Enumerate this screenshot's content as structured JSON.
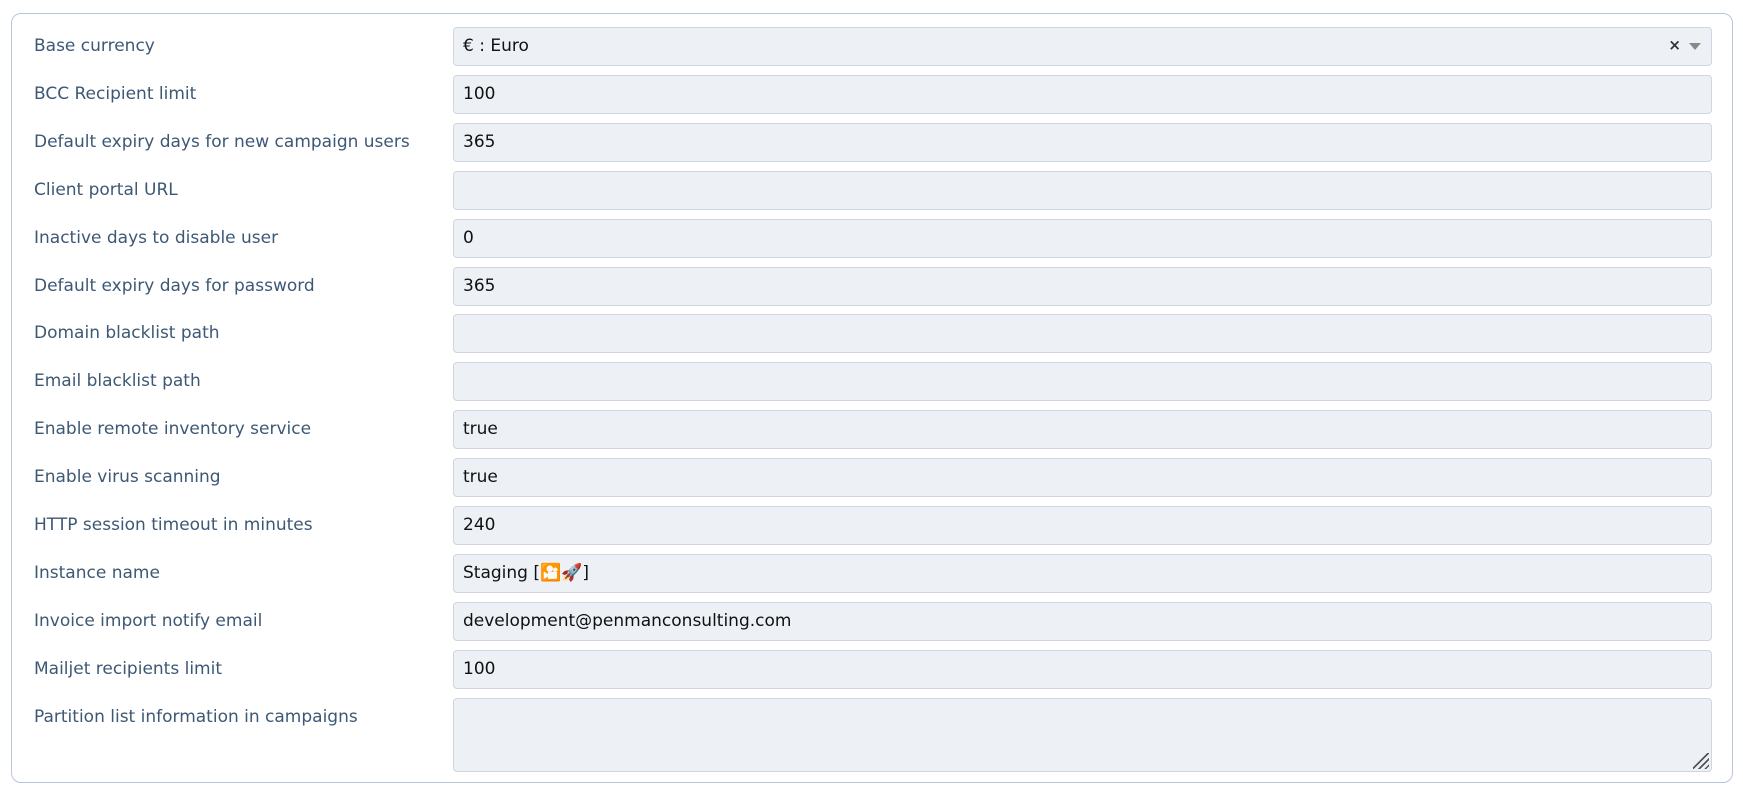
{
  "settings": [
    {
      "label": "Base currency",
      "value": "€ : Euro",
      "type": "select"
    },
    {
      "label": "BCC Recipient limit",
      "value": "100",
      "type": "input"
    },
    {
      "label": "Default expiry days for new campaign users",
      "value": "365",
      "type": "input"
    },
    {
      "label": "Client portal URL",
      "value": "",
      "type": "input"
    },
    {
      "label": "Inactive days to disable user",
      "value": "0",
      "type": "input"
    },
    {
      "label": "Default expiry days for password",
      "value": "365",
      "type": "input"
    },
    {
      "label": "Domain blacklist path",
      "value": "",
      "type": "input"
    },
    {
      "label": "Email blacklist path",
      "value": "",
      "type": "input"
    },
    {
      "label": "Enable remote inventory service",
      "value": "true",
      "type": "input"
    },
    {
      "label": "Enable virus scanning",
      "value": "true",
      "type": "input"
    },
    {
      "label": "HTTP session timeout in minutes",
      "value": "240",
      "type": "input"
    },
    {
      "label": "Instance name",
      "value": "Staging [🎦🚀]",
      "type": "input"
    },
    {
      "label": "Invoice import notify email",
      "value": "development@penmanconsulting.com",
      "type": "input"
    },
    {
      "label": "Mailjet recipients limit",
      "value": "100",
      "type": "input"
    },
    {
      "label": "Partition list information in campaigns",
      "value": "",
      "type": "textarea"
    }
  ],
  "select_icons": {
    "clear": "×",
    "caret": "caret-down-icon"
  }
}
